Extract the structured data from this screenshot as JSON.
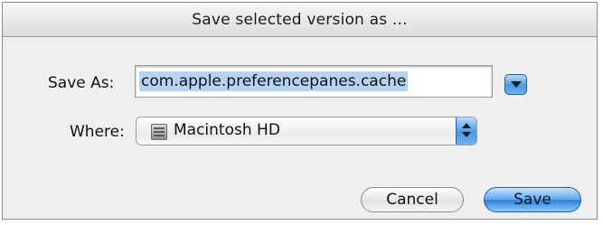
{
  "dialog": {
    "title": "Save selected version as ..."
  },
  "form": {
    "save_as_label": "Save As:",
    "save_as_value": "com.apple.preferencepanes.cache",
    "where_label": "Where:",
    "where_value": "Macintosh HD",
    "where_icon": "hard-disk-icon"
  },
  "buttons": {
    "cancel_label": "Cancel",
    "save_label": "Save"
  },
  "colors": {
    "accent": "#4d97e1",
    "selection": "#b6d3f3"
  }
}
